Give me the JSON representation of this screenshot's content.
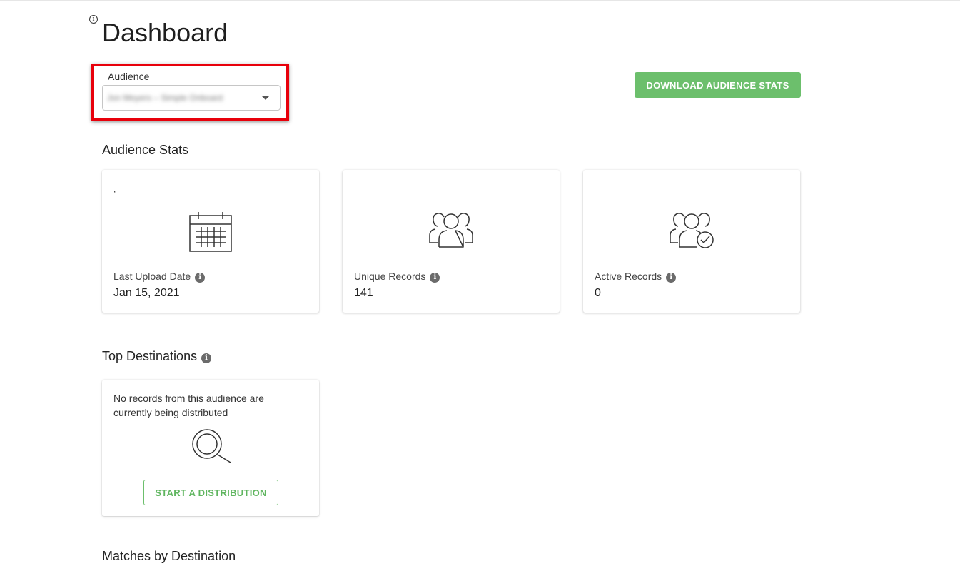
{
  "page": {
    "title": "Dashboard",
    "info_glyph": "i"
  },
  "audience": {
    "label": "Audience",
    "selected_value": "Jon Meyers – Simple Onboard",
    "value_blurred": true
  },
  "actions": {
    "download_label": "DOWNLOAD AUDIENCE STATS"
  },
  "audience_stats": {
    "section_title": "Audience Stats",
    "cards": [
      {
        "label": "Last Upload Date",
        "value": "Jan 15, 2021",
        "icon": "calendar-icon",
        "extra_mark": ","
      },
      {
        "label": "Unique Records",
        "value": "141",
        "icon": "people-icon"
      },
      {
        "label": "Active Records",
        "value": "0",
        "icon": "people-check-icon"
      }
    ]
  },
  "top_destinations": {
    "section_title": "Top Destinations",
    "empty_message": "No records from this audience are currently being distributed",
    "icon": "magnifier-icon",
    "start_label": "START A DISTRIBUTION"
  },
  "matches_by_destination": {
    "section_title": "Matches by Destination"
  },
  "colors": {
    "accent_green": "#6cbf6c",
    "highlight_red": "#e8000b",
    "info_gray": "#6b6b6b"
  }
}
